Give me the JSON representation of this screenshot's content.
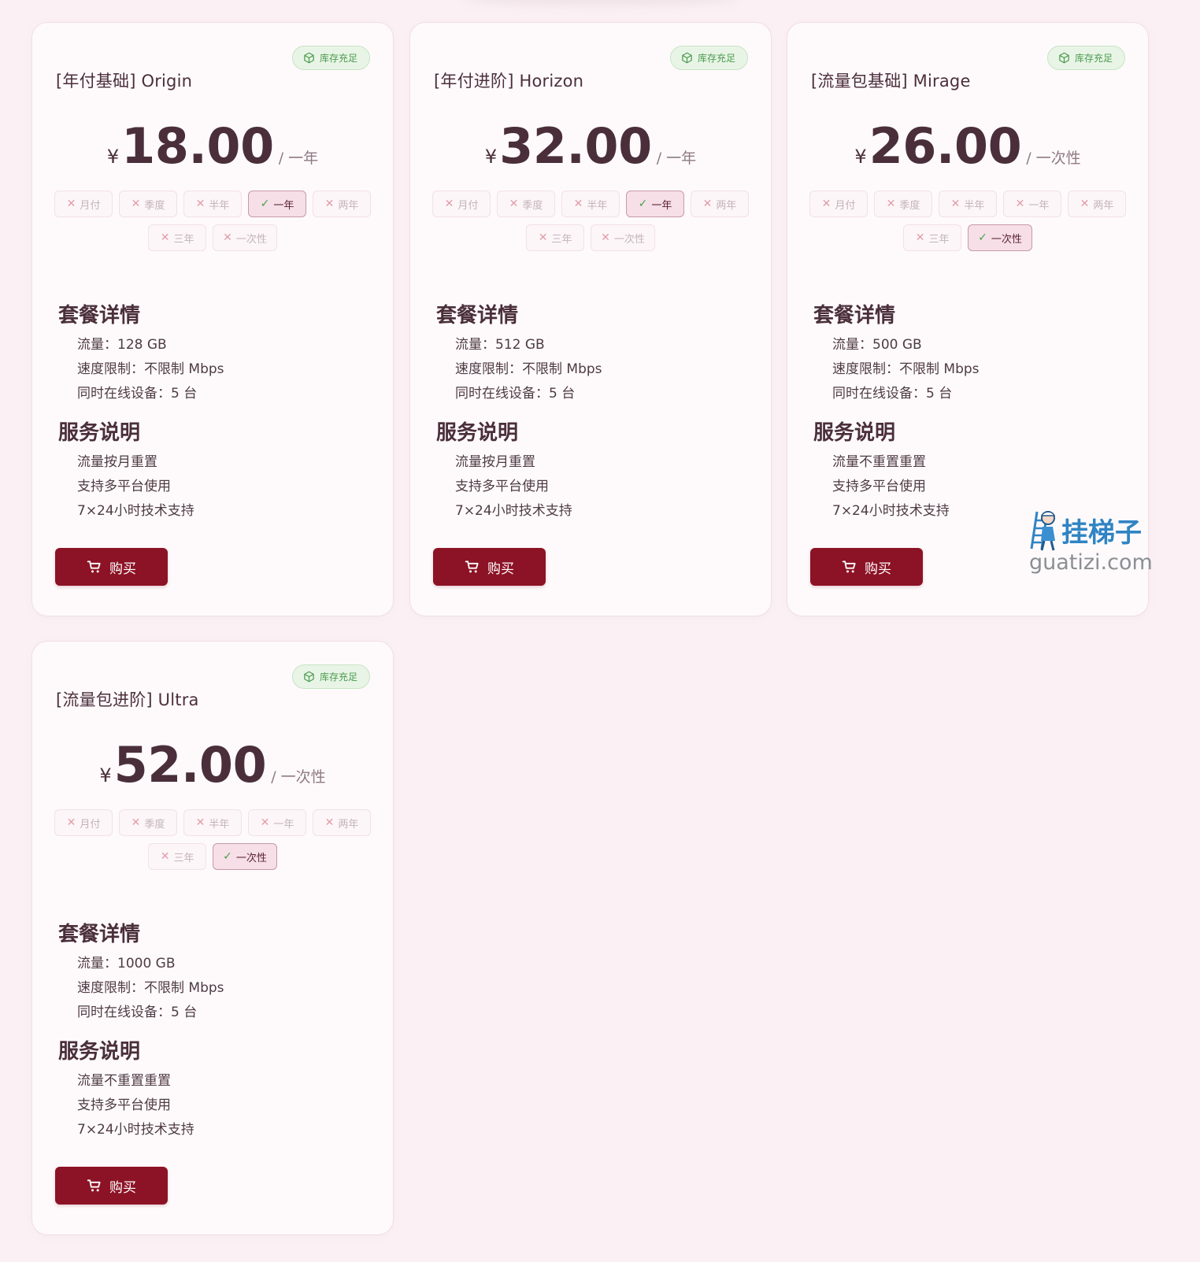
{
  "badge_label": "库存充足",
  "section_titles": {
    "details": "套餐详情",
    "service": "服务说明"
  },
  "buy_label": "购买",
  "watermark": {
    "zh": "挂梯子",
    "en": "guatizi.com"
  },
  "cycle_labels": [
    "月付",
    "季度",
    "半年",
    "一年",
    "两年",
    "三年",
    "一次性"
  ],
  "plans": [
    {
      "name": "[年付基础] Origin",
      "currency": "¥",
      "price": "18.00",
      "period": "/ 一年",
      "selected_cycle": "一年",
      "details": [
        "流量：128 GB",
        "速度限制：不限制 Mbps",
        "同时在线设备：5 台"
      ],
      "service": [
        "流量按月重置",
        "支持多平台使用",
        "7×24小时技术支持"
      ]
    },
    {
      "name": "[年付进阶] Horizon",
      "currency": "¥",
      "price": "32.00",
      "period": "/ 一年",
      "selected_cycle": "一年",
      "details": [
        "流量：512 GB",
        "速度限制：不限制 Mbps",
        "同时在线设备：5 台"
      ],
      "service": [
        "流量按月重置",
        "支持多平台使用",
        "7×24小时技术支持"
      ]
    },
    {
      "name": "[流量包基础] Mirage",
      "currency": "¥",
      "price": "26.00",
      "period": "/ 一次性",
      "selected_cycle": "一次性",
      "details": [
        "流量：500 GB",
        "速度限制：不限制 Mbps",
        "同时在线设备：5 台"
      ],
      "service": [
        "流量不重置重置",
        "支持多平台使用",
        "7×24小时技术支持"
      ]
    },
    {
      "name": "[流量包进阶] Ultra",
      "currency": "¥",
      "price": "52.00",
      "period": "/ 一次性",
      "selected_cycle": "一次性",
      "details": [
        "流量：1000 GB",
        "速度限制：不限制 Mbps",
        "同时在线设备：5 台"
      ],
      "service": [
        "流量不重置重置",
        "支持多平台使用",
        "7×24小时技术支持"
      ]
    }
  ]
}
